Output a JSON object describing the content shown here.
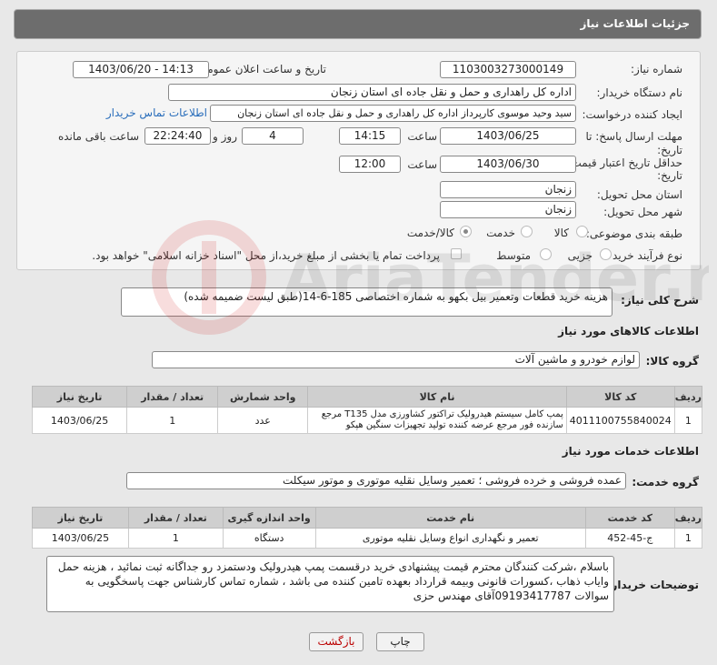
{
  "header": {
    "title": "جزئیات اطلاعات نیاز"
  },
  "form": {
    "need_number_label": "شماره نیاز:",
    "need_number": "1103003273000149",
    "announce_label": "تاریخ و ساعت اعلان عمومی:",
    "announce_value": "1403/06/20 - 14:13",
    "buyer_org_label": "نام دستگاه خریدار:",
    "buyer_org": "اداره کل راهداری و حمل و نقل جاده ای استان زنجان",
    "requester_label": "ایجاد کننده درخواست:",
    "requester": "سید وحید موسوی کارپرداز اداره کل راهداری و حمل و نقل جاده ای استان زنجان",
    "contact_link": "اطلاعات تماس خریدار",
    "deadline_label": "مهلت ارسال پاسخ: تا",
    "deadline_label2": "تاریخ:",
    "deadline_date": "1403/06/25",
    "time_label": "ساعت",
    "deadline_time": "14:15",
    "days_value": "4",
    "days_label": "روز و",
    "remaining_time": "22:24:40",
    "remaining_label": "ساعت باقی مانده",
    "validity_label": "حداقل تاریخ اعتبار قیمت: تا",
    "validity_label2": "تاریخ:",
    "validity_date": "1403/06/30",
    "validity_time": "12:00",
    "province_label": "استان محل تحویل:",
    "province": "زنجان",
    "city_label": "شهر محل تحویل:",
    "city": "زنجان",
    "category_label": "طبقه بندی موضوعی:",
    "category_options": [
      "کالا",
      "خدمت",
      "کالا/خدمت"
    ],
    "process_label": "نوع فرآیند خرید :",
    "process_options": [
      "جزیی",
      "متوسط"
    ],
    "payment_note": "پرداخت تمام یا بخشی از مبلغ خرید،از محل \"اسناد خزانه اسلامی\" خواهد بود."
  },
  "need_desc": {
    "label": "شرح کلی نیاز:",
    "value": "هزینه خرید قطعات وتعمیر بیل بکهو به شماره اختصاصی 185-6-14(طبق لیست ضمیمه شده)"
  },
  "goods": {
    "section_title": "اطلاعات کالاهای مورد نیاز",
    "group_label": "گروه کالا:",
    "group_value": "لوازم خودرو و ماشین آلات",
    "headers": [
      "ردیف",
      "کد کالا",
      "نام کالا",
      "واحد شمارش",
      "تعداد / مقدار",
      "تاریخ نیاز"
    ],
    "rows": [
      {
        "idx": "1",
        "code": "4011100755840024",
        "name": "پمپ کامل سیستم هیدرولیک تراکتور کشاورزی مدل T135 مرجع سازنده فور مرجع عرضه کننده تولید تجهیزات سنگین هپکو",
        "unit": "عدد",
        "qty": "1",
        "date": "1403/06/25"
      }
    ]
  },
  "services": {
    "section_title": "اطلاعات خدمات مورد نیاز",
    "group_label": "گروه خدمت:",
    "group_value": "عمده فروشی و خرده فروشی ؛ تعمیر وسایل نقلیه موتوری و موتور سیکلت",
    "headers": [
      "ردیف",
      "کد خدمت",
      "نام خدمت",
      "واحد اندازه گیری",
      "تعداد / مقدار",
      "تاریخ نیاز"
    ],
    "rows": [
      {
        "idx": "1",
        "code": "ج-45-452",
        "name": "تعمیر و نگهداری انواع وسایل نقلیه موتوری",
        "unit": "دستگاه",
        "qty": "1",
        "date": "1403/06/25"
      }
    ]
  },
  "buyer_notes": {
    "label": "توضیحات خریدار:",
    "value": "باسلام ،شرکت کنندگان محترم قیمت پیشنهادی خرید درقسمت پمپ هیدرولیک ودستمزد رو جداگانه ثبت نمائید ، هزینه حمل وایاب ذهاب ،کسورات قانونی وبیمه قرارداد بعهده تامین کننده می باشد ، شماره تماس کارشناس جهت پاسخگویی به سوالات 09193417787آقای مهندس حزی"
  },
  "buttons": {
    "print": "چاپ",
    "back": "بازگشت"
  },
  "watermark": {
    "text": "AriaTender.neT"
  }
}
